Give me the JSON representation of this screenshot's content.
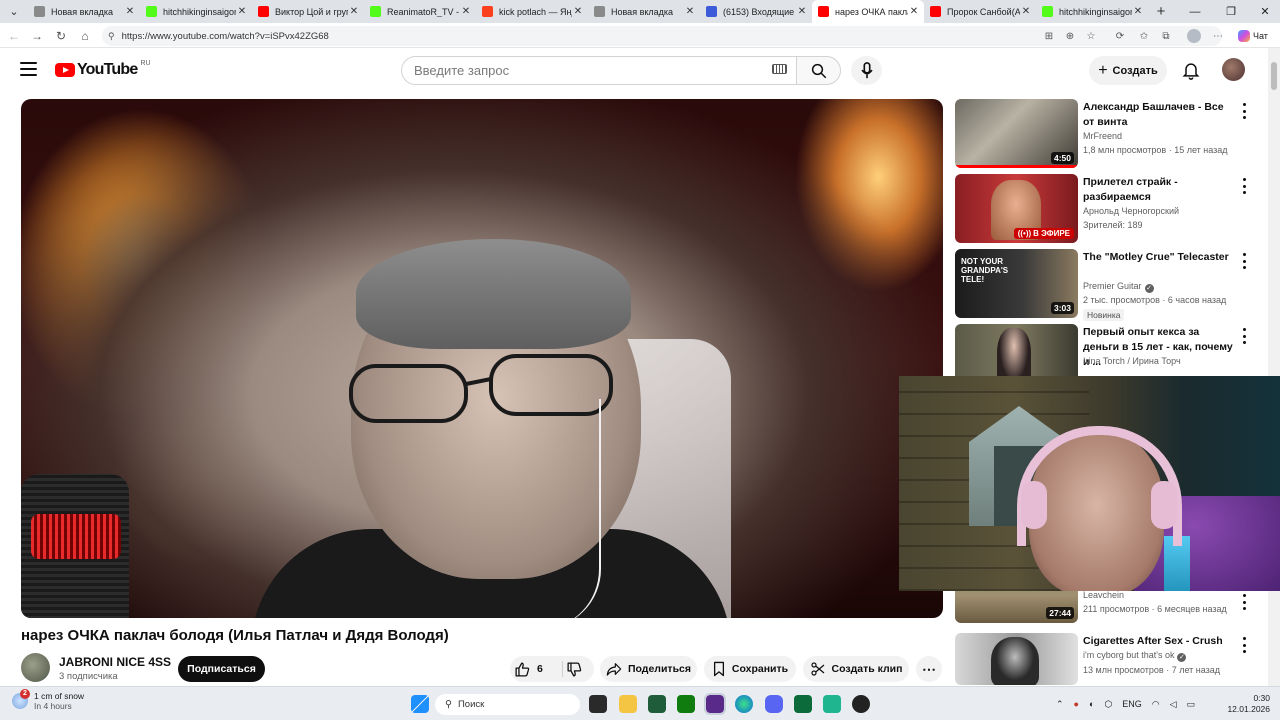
{
  "browser": {
    "tabs": [
      {
        "label": "Новая вкладка",
        "icon": "page-icon",
        "color": "#8a8a8a"
      },
      {
        "label": "hitchhikinginsaigon",
        "icon": "kick-icon",
        "color": "#53fc18"
      },
      {
        "label": "Виктор Цой и групп",
        "icon": "youtube-icon",
        "color": "#ff0000"
      },
      {
        "label": "ReanimatoR_TV - W",
        "icon": "kick-icon",
        "color": "#53fc18"
      },
      {
        "label": "kick potlach — Янд",
        "icon": "yandex-icon",
        "color": "#fc3f1d"
      },
      {
        "label": "Новая вкладка",
        "icon": "page-icon",
        "color": "#8a8a8a"
      },
      {
        "label": "(6153) Входящие —",
        "icon": "mail-icon",
        "color": "#3b5bd9"
      },
      {
        "label": "нарез ОЧКА паклач",
        "icon": "youtube-icon",
        "color": "#ff0000"
      },
      {
        "label": "Пророк Санбой(А",
        "icon": "youtube-icon",
        "color": "#ff0000"
      },
      {
        "label": "hitchhikinginsaigon",
        "icon": "kick-icon",
        "color": "#53fc18"
      }
    ],
    "active_tab": 7,
    "url": "https://www.youtube.com/watch?v=iSPvx42ZG68",
    "chat_label": "Чат"
  },
  "youtube": {
    "logo_text": "YouTube",
    "country_code": "RU",
    "search_placeholder": "Введите запрос",
    "create_label": "Создать",
    "brand_color": "#ff0000"
  },
  "video": {
    "title": "нарез ОЧКА паклач болодя (Илья Патлач и Дядя Володя)",
    "channel": "JABRONI NICE 4SS",
    "subscribers": "3 подписчика",
    "subscribe_label": "Подписаться",
    "likes": "6",
    "share_label": "Поделиться",
    "save_label": "Сохранить",
    "clip_label": "Создать клип"
  },
  "recommendations": [
    {
      "title": "Александр Башлачев - Все от винта",
      "channel": "MrFreend",
      "meta": "1,8 млн просмотров · 15 лет назад",
      "duration": "4:50",
      "verified": false,
      "badge": ""
    },
    {
      "title": "Прилетел страйк - разбираемся",
      "channel": "Арнольд Черногорский",
      "meta": "Зрителей: 189",
      "duration": "",
      "live_label": "В ЭФИРЕ",
      "verified": false,
      "badge": ""
    },
    {
      "title": "The \"Motley Crue\" Telecaster",
      "channel": "Premier Guitar",
      "meta": "2 тыс. просмотров · 6 часов назад",
      "duration": "3:03",
      "verified": true,
      "badge": "Новинка"
    },
    {
      "title": "Первый опыт кекса за деньги в 15 лет - как, почему и ...",
      "channel": "Irina Torch / Ирина Торч",
      "meta": "",
      "duration": "",
      "verified": false,
      "badge": ""
    },
    {
      "title": "",
      "channel": "Leavchein",
      "meta": "211 просмотров · 6 месяцев назад",
      "duration": "27:44",
      "verified": false,
      "badge": ""
    },
    {
      "title": "Cigarettes After Sex - Crush",
      "channel": "i'm cyborg but that's ok",
      "meta": "13 млн просмотров · 7 лет назад",
      "duration": "",
      "verified": true,
      "badge": ""
    }
  ],
  "taskbar": {
    "weather_text": "1 cm of snow",
    "weather_sub": "In 4 hours",
    "weather_badge": "2",
    "search_placeholder": "Поиск",
    "language": "ENG",
    "time": "0:30",
    "date": "12.01.2026"
  }
}
